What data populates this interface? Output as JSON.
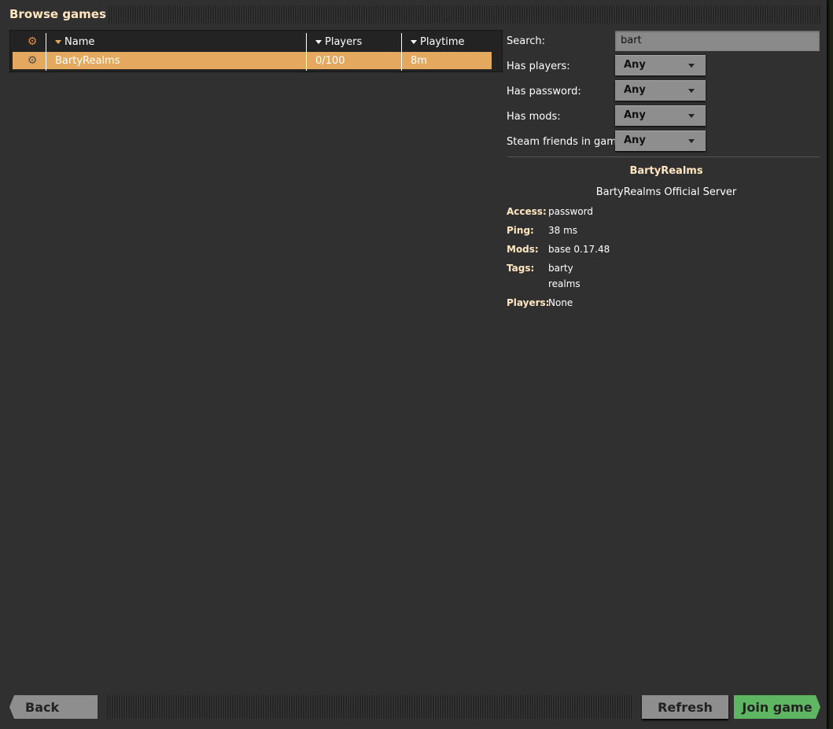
{
  "window": {
    "title": "Browse games"
  },
  "table": {
    "columns": [
      "Name",
      "Players",
      "Playtime"
    ],
    "rows": [
      {
        "name": "BartyRealms",
        "players": "0/100",
        "playtime": "8m",
        "icon": "gear-icon"
      }
    ]
  },
  "filters": {
    "search_label": "Search:",
    "search_value": "bart",
    "items": [
      {
        "label": "Has players:",
        "value": "Any"
      },
      {
        "label": "Has password:",
        "value": "Any"
      },
      {
        "label": "Has mods:",
        "value": "Any"
      },
      {
        "label": "Steam friends in game:",
        "value": "Any"
      }
    ]
  },
  "details": {
    "name": "BartyRealms",
    "description": "BartyRealms Official Server",
    "access_label": "Access:",
    "access": "password",
    "ping_label": "Ping:",
    "ping": "38 ms",
    "mods_label": "Mods:",
    "mods": "base 0.17.48",
    "tags_label": "Tags:",
    "tags": [
      "barty",
      "realms"
    ],
    "players_label": "Players:",
    "players": "None"
  },
  "buttons": {
    "back": "Back",
    "refresh": "Refresh",
    "join": "Join game"
  },
  "colors": {
    "selected_row": "#e4a95e",
    "join": "#5eb663",
    "heading": "#ffe6c0"
  }
}
